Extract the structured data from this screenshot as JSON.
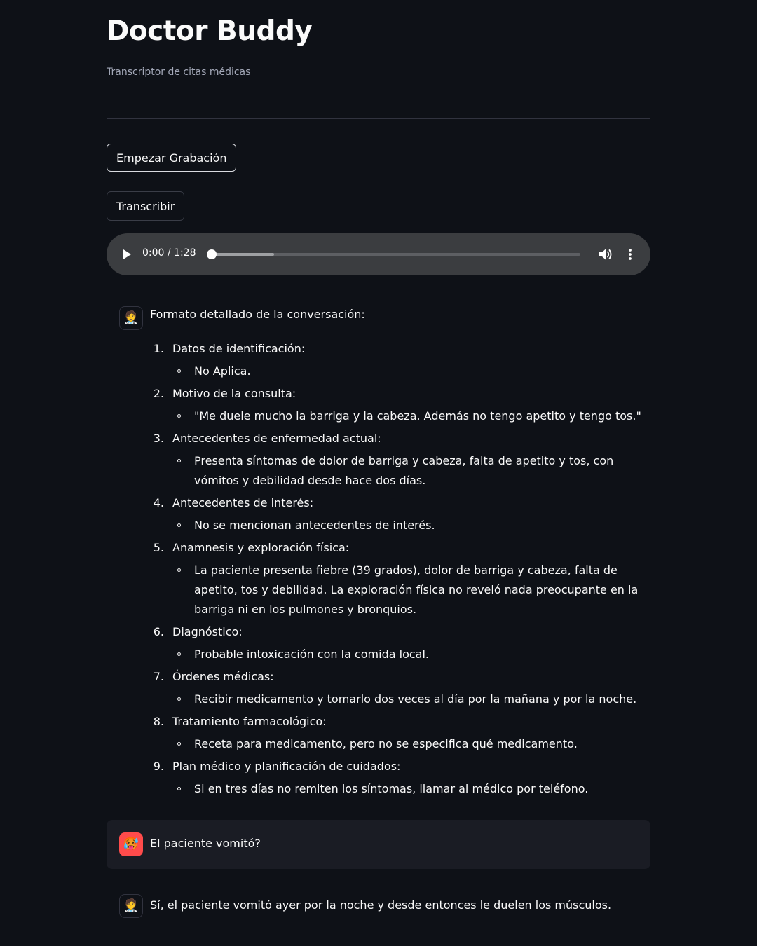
{
  "header": {
    "title": "Doctor Buddy",
    "subtitle": "Transcriptor de citas médicas"
  },
  "buttons": {
    "record_label": "Empezar Grabación",
    "transcribe_label": "Transcribir"
  },
  "audio_player": {
    "time_display": "0:00 / 1:28",
    "played_fraction": 0.0,
    "buffered_fraction": 0.17
  },
  "chat": {
    "assistant_intro": "Formato detallado de la conversación:",
    "sections": [
      {
        "number": "1.",
        "title": "Datos de identificación:",
        "detail": "No Aplica."
      },
      {
        "number": "2.",
        "title": "Motivo de la consulta:",
        "detail": "\"Me duele mucho la barriga y la cabeza. Además no tengo apetito y tengo tos.\""
      },
      {
        "number": "3.",
        "title": "Antecedentes de enfermedad actual:",
        "detail": "Presenta síntomas de dolor de barriga y cabeza, falta de apetito y tos, con vómitos y debilidad desde hace dos días."
      },
      {
        "number": "4.",
        "title": "Antecedentes de interés:",
        "detail": "No se mencionan antecedentes de interés."
      },
      {
        "number": "5.",
        "title": "Anamnesis y exploración física:",
        "detail": "La paciente presenta fiebre (39 grados), dolor de barriga y cabeza, falta de apetito, tos y debilidad. La exploración física no reveló nada preocupante en la barriga ni en los pulmones y bronquios."
      },
      {
        "number": "6.",
        "title": "Diagnóstico:",
        "detail": "Probable intoxicación con la comida local."
      },
      {
        "number": "7.",
        "title": "Órdenes médicas:",
        "detail": "Recibir medicamento y tomarlo dos veces al día por la mañana y por la noche."
      },
      {
        "number": "8.",
        "title": "Tratamiento farmacológico:",
        "detail": "Receta para medicamento, pero no se especifica qué medicamento."
      },
      {
        "number": "9.",
        "title": "Plan médico y planificación de cuidados:",
        "detail": "Si en tres días no remiten los síntomas, llamar al médico por teléfono."
      }
    ],
    "user_question": "El paciente vomitó?",
    "assistant_answer": "Sí, el paciente vomitó ayer por la noche y desde entonces le duelen los músculos."
  },
  "icons": {
    "assistant_avatar": "🧑‍⚕️",
    "user_avatar": "🥵"
  },
  "colors": {
    "background": "#0e1117",
    "user_message_bg": "#1a1c24",
    "user_avatar_bg": "#ff4b4b",
    "audio_player_bg": "#3b3d40"
  }
}
